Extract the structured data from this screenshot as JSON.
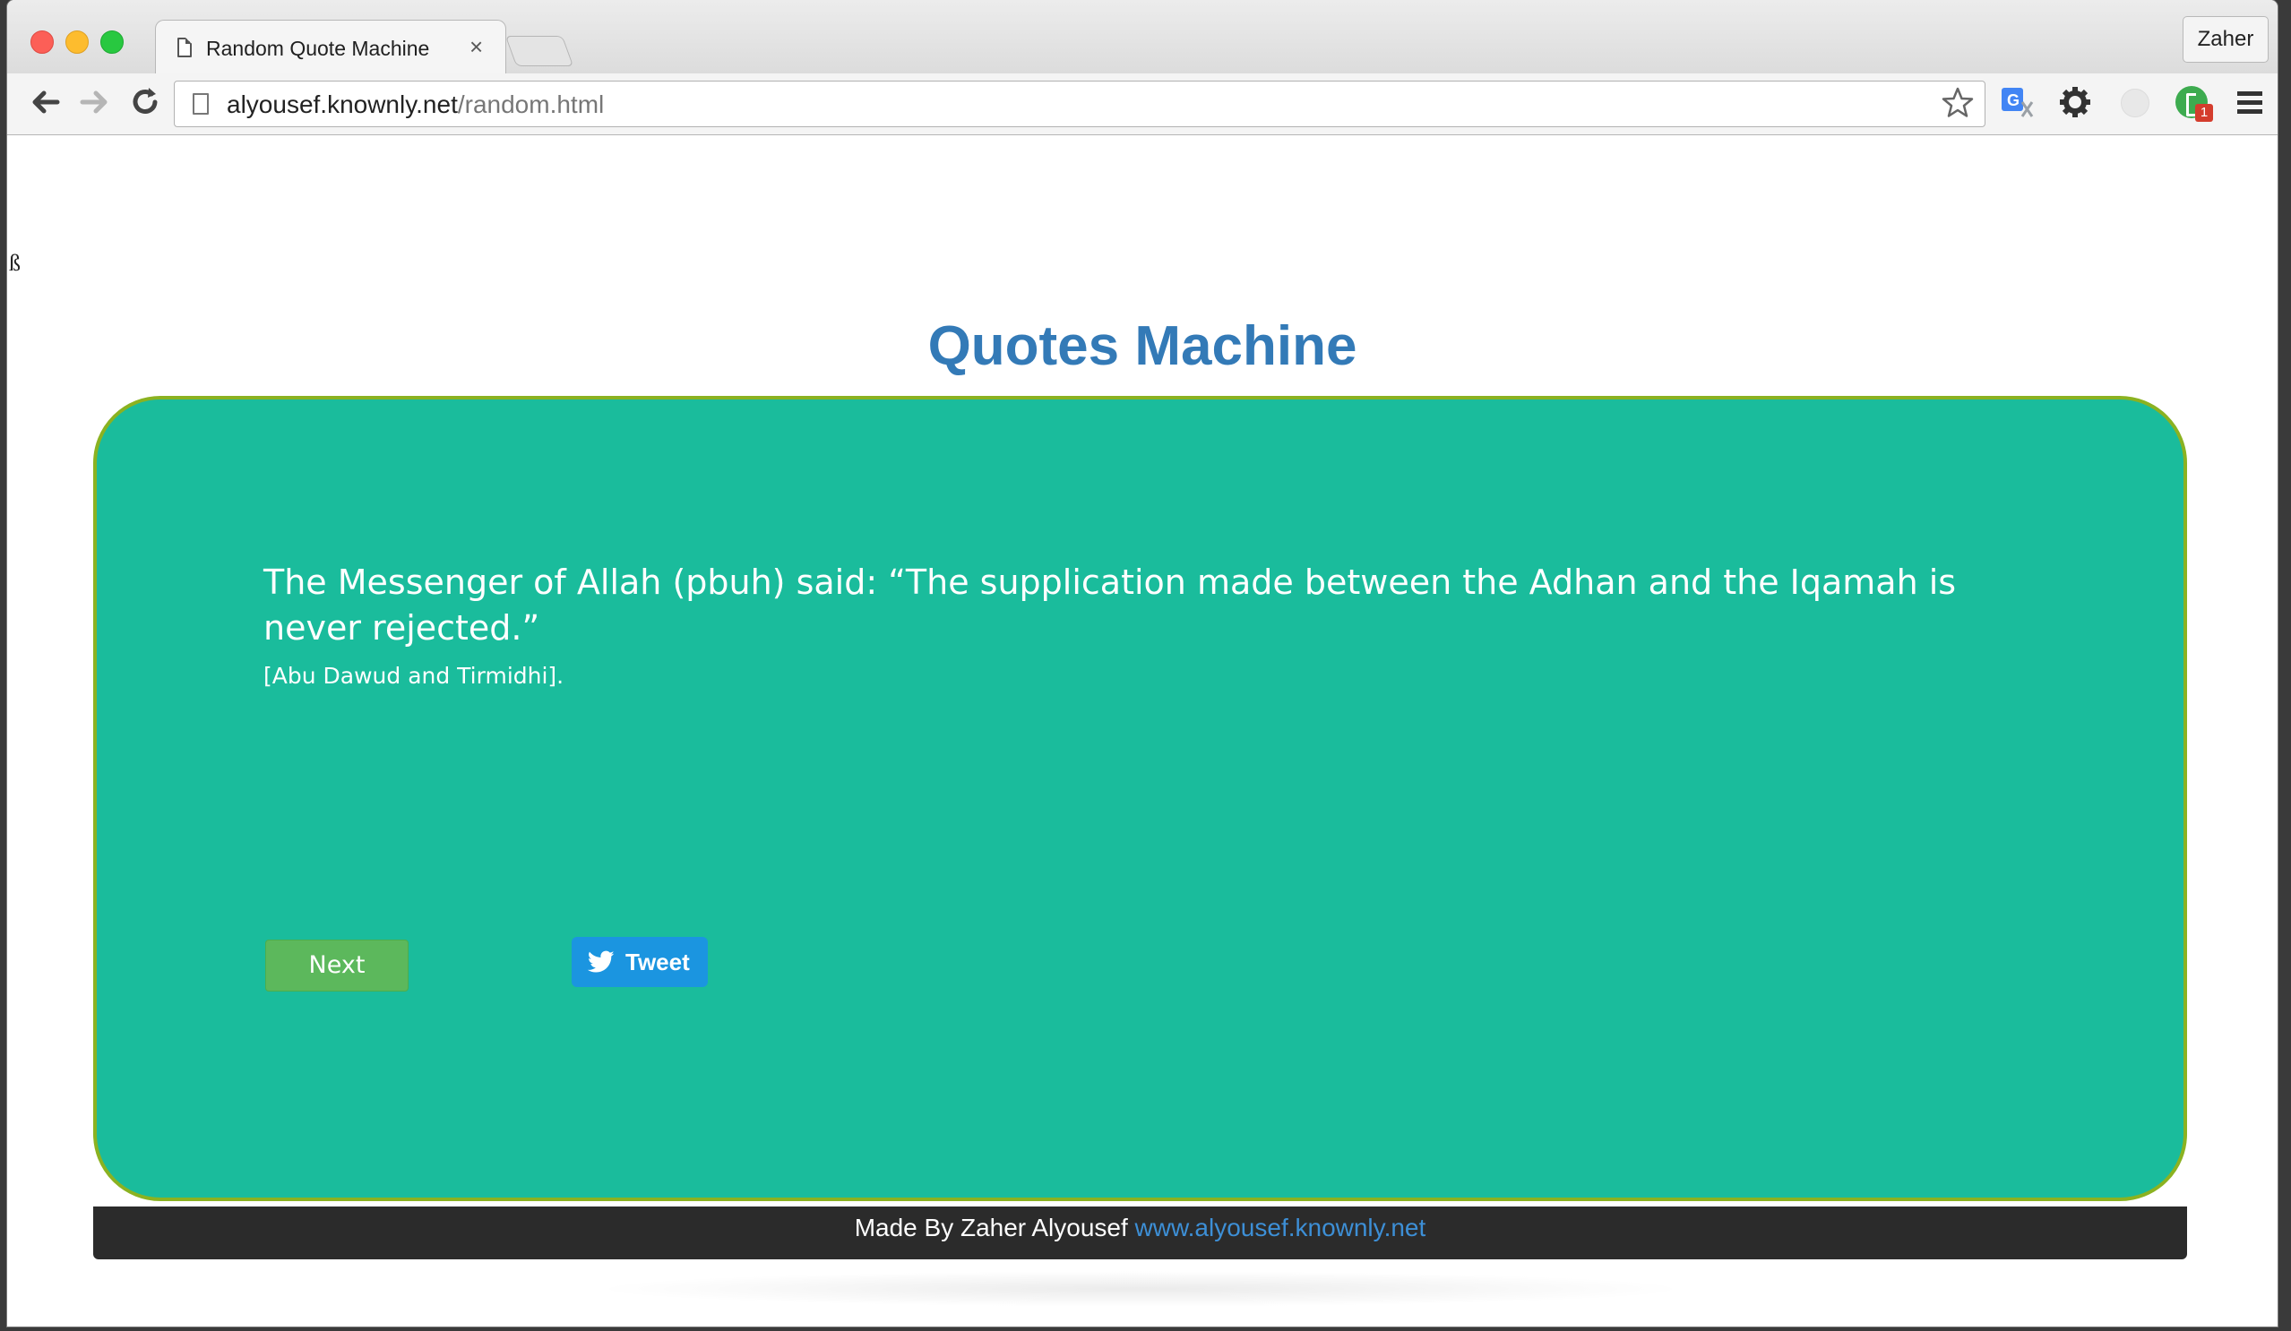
{
  "browser": {
    "tab_title": "Random Quote Machine",
    "tab_close": "×",
    "profile_name": "Zaher",
    "url_host": "alyousef.knownly.net",
    "url_path": "/random.html",
    "extension_badge": "1"
  },
  "page": {
    "stray_char": "ß",
    "heading": "Quotes Machine",
    "quote": {
      "text": "The Messenger of Allah (pbuh) said: “The supplication made between the Adhan and the Iqamah is never rejected.”",
      "source": "[Abu Dawud and Tirmidhi]."
    },
    "buttons": {
      "next_label": "Next",
      "tweet_label": "Tweet"
    },
    "footer": {
      "text": "Made By Zaher Alyousef ",
      "link_text": "www.alyousef.knownly.net"
    }
  },
  "colors": {
    "heading": "#337ab7",
    "card": "#1abc9c",
    "card_border": "#8bb221",
    "next_button": "#5cb85c",
    "tweet_button": "#1b95e0",
    "footer_bg": "#2b2b2b",
    "footer_link": "#3d8fd6"
  },
  "icons": [
    "back-arrow-icon",
    "forward-arrow-icon",
    "reload-icon",
    "page-icon",
    "bookmark-star-icon",
    "translate-icon",
    "gear-icon",
    "ghost-extension-icon",
    "green-extension-icon",
    "menu-icon",
    "twitter-bird-icon"
  ]
}
